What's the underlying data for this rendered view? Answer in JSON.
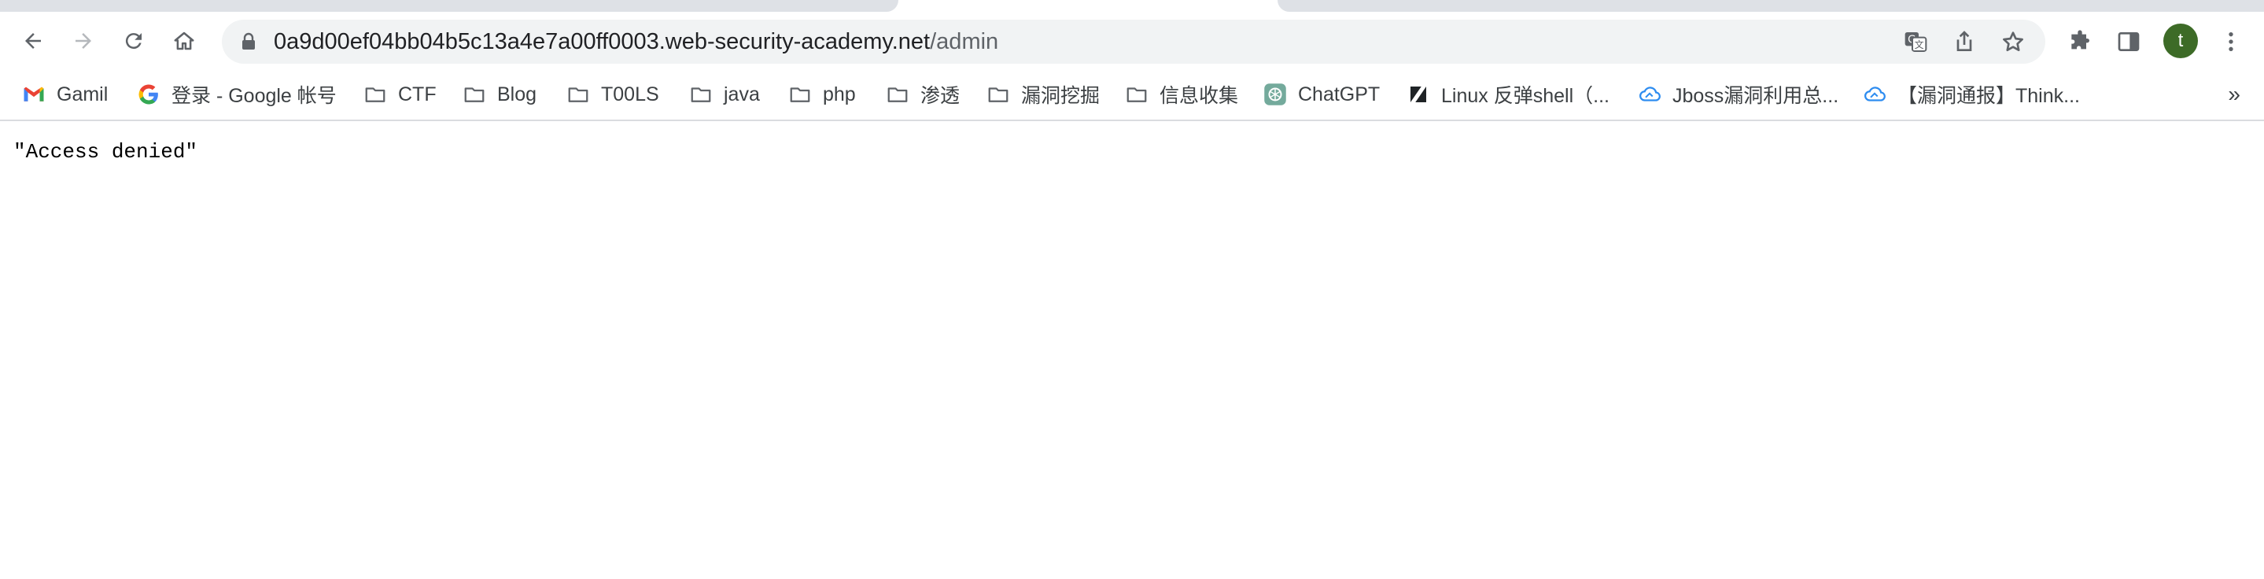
{
  "browser": {
    "url_host": "0a9d00ef04bb04b5c13a4e7a00ff0003.web-security-academy.net",
    "url_path": "/admin",
    "profile_initial": "t",
    "profile_color": "#3d6b27"
  },
  "bookmarks": {
    "items": [
      {
        "label": "Gamil",
        "icon": "gmail-icon"
      },
      {
        "label": "登录 - Google 帐号",
        "icon": "google-icon"
      },
      {
        "label": "CTF",
        "icon": "folder-icon"
      },
      {
        "label": "Blog",
        "icon": "folder-icon"
      },
      {
        "label": "T00LS",
        "icon": "folder-icon"
      },
      {
        "label": "java",
        "icon": "folder-icon"
      },
      {
        "label": "php",
        "icon": "folder-icon"
      },
      {
        "label": "渗透",
        "icon": "folder-icon"
      },
      {
        "label": "漏洞挖掘",
        "icon": "folder-icon"
      },
      {
        "label": "信息收集",
        "icon": "folder-icon"
      },
      {
        "label": "ChatGPT",
        "icon": "chatgpt-icon"
      },
      {
        "label": "Linux 反弹shell（...",
        "icon": "zhihu-slash-icon"
      },
      {
        "label": "Jboss漏洞利用总...",
        "icon": "cloud-icon"
      },
      {
        "label": "【漏洞通报】Think...",
        "icon": "cloud-icon"
      }
    ],
    "overflow_label": "»"
  },
  "page": {
    "text": "\"Access denied\""
  }
}
